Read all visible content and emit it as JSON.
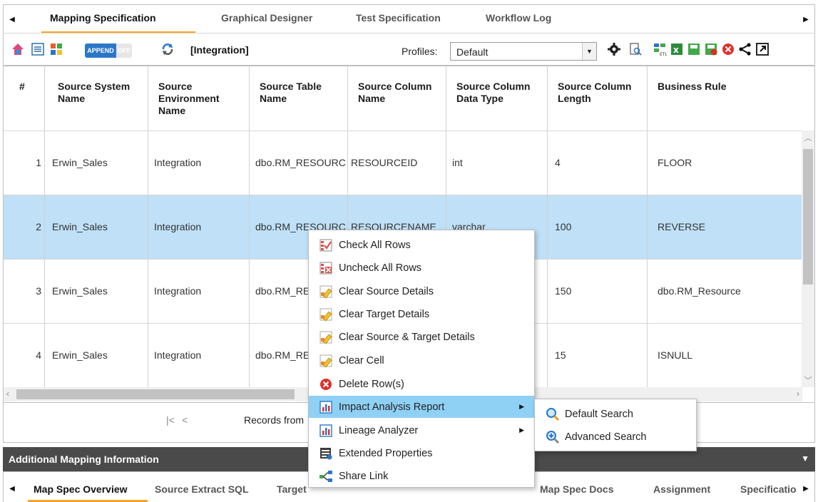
{
  "tabs": {
    "items": [
      "Mapping Specification",
      "Graphical Designer",
      "Test Specification",
      "Workflow Log"
    ],
    "active": "Mapping Specification"
  },
  "toolbar": {
    "append_on": "APPEND",
    "append_off": "OFF",
    "context_label": "[Integration]",
    "profiles_label": "Profiles:",
    "profiles_value": "Default"
  },
  "grid": {
    "columns": [
      "#",
      "Source System Name",
      "Source Environment Name",
      "Source Table Name",
      "Source Column Name",
      "Source Column Data Type",
      "Source Column Length",
      "Business Rule"
    ],
    "rows": [
      {
        "num": "1",
        "system": "Erwin_Sales",
        "env": "Integration",
        "table": "dbo.RM_RESOURC",
        "column": "RESOURCEID",
        "type": "int",
        "length": "4",
        "rule": "FLOOR"
      },
      {
        "num": "2",
        "system": "Erwin_Sales",
        "env": "Integration",
        "table": "dbo.RM_RESOURC",
        "column": "RESOURCENAME",
        "type": "varchar",
        "length": "100",
        "rule": "REVERSE"
      },
      {
        "num": "3",
        "system": "Erwin_Sales",
        "env": "Integration",
        "table": "dbo.RM_RE",
        "column": "",
        "type": "",
        "length": "150",
        "rule": "dbo.RM_Resource"
      },
      {
        "num": "4",
        "system": "Erwin_Sales",
        "env": "Integration",
        "table": "dbo.RM_RE",
        "column": "",
        "type": "",
        "length": "15",
        "rule": "ISNULL"
      }
    ],
    "selected_row": 2
  },
  "pager": {
    "first": "|<",
    "prev": "<",
    "records": "Records from"
  },
  "additional": {
    "title": "Additional Mapping Information",
    "tabs": [
      "Map Spec Overview",
      "Source Extract SQL",
      "Target",
      "Map Spec Docs",
      "Assignment",
      "Specificatio"
    ],
    "active": "Map Spec Overview"
  },
  "context_menu": {
    "items": [
      {
        "label": "Check All Rows",
        "icon": "check-rows-icon"
      },
      {
        "label": "Uncheck All Rows",
        "icon": "uncheck-rows-icon"
      },
      {
        "label": "Clear Source Details",
        "icon": "eraser-icon"
      },
      {
        "label": "Clear Target Details",
        "icon": "eraser-icon"
      },
      {
        "label": "Clear Source & Target Details",
        "icon": "eraser-icon"
      },
      {
        "label": "Clear Cell",
        "icon": "eraser-icon"
      },
      {
        "label": "Delete Row(s)",
        "icon": "delete-icon"
      },
      {
        "label": "Impact Analysis Report",
        "icon": "report-icon",
        "submenu": true
      },
      {
        "label": "Lineage Analyzer",
        "icon": "report-icon",
        "submenu": true
      },
      {
        "label": "Extended Properties",
        "icon": "properties-icon"
      },
      {
        "label": "Share Link",
        "icon": "share-link-icon"
      }
    ],
    "highlighted": "Impact Analysis Report",
    "submenu": [
      {
        "label": "Default Search",
        "icon": "search-icon"
      },
      {
        "label": "Advanced Search",
        "icon": "advanced-search-icon"
      }
    ]
  },
  "colors": {
    "accent": "#f5a623",
    "selected_row": "#bfe0f7",
    "menu_highlight": "#8fd0f5",
    "dark_bar": "#4a4a4a",
    "toggle_blue": "#2b77c7"
  }
}
